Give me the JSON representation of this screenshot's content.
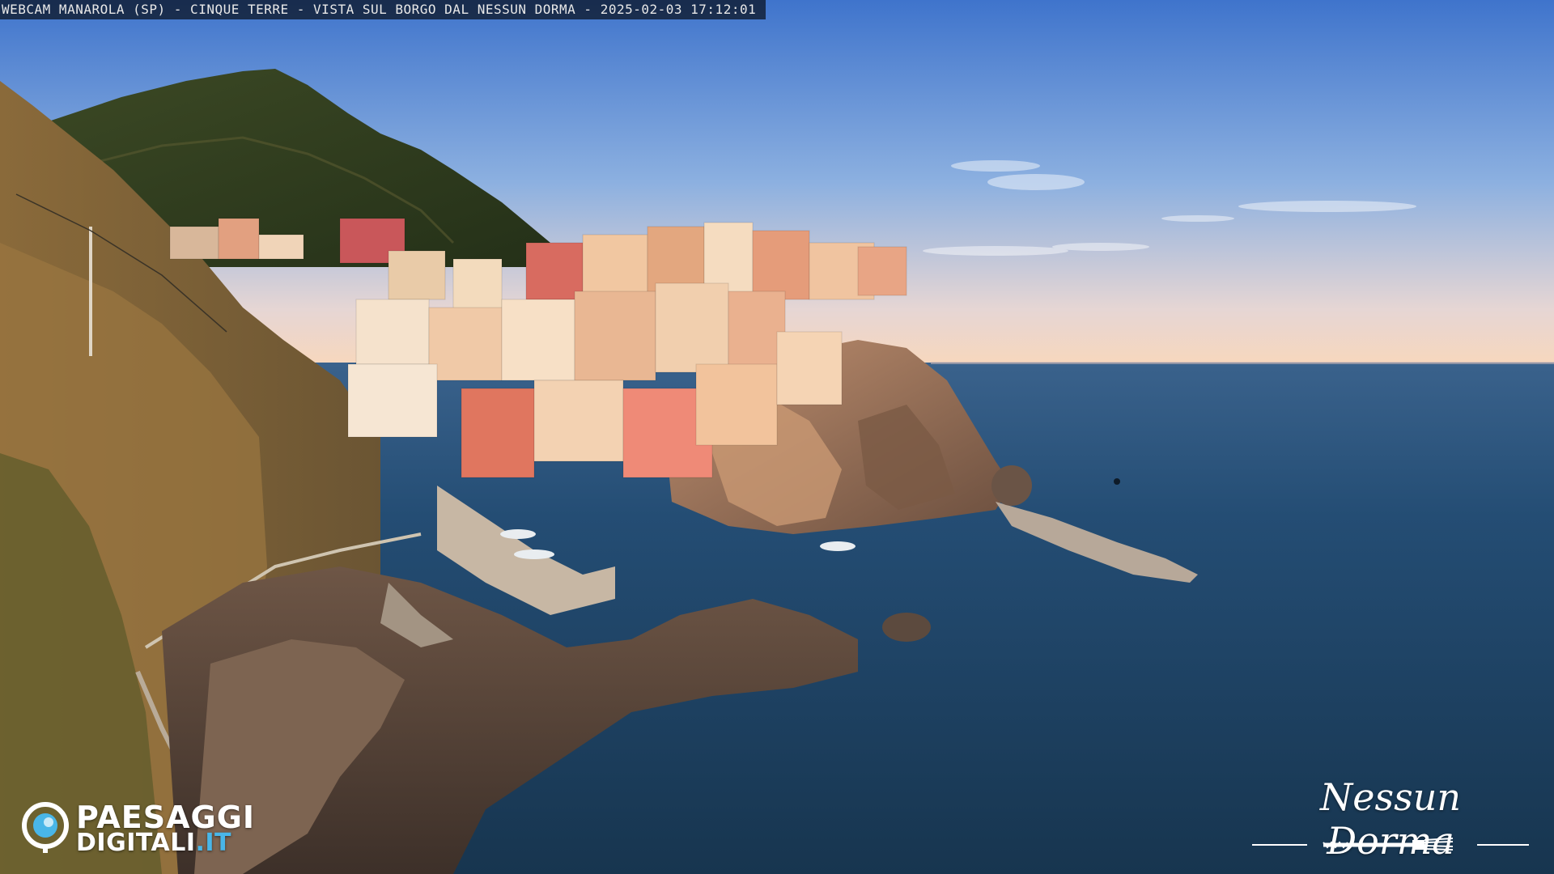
{
  "overlay": {
    "caption": "WEBCAM MANAROLA (SP) - CINQUE TERRE - VISTA SUL BORGO DAL NESSUN DORMA - 2025-02-03 17:12:01"
  },
  "logos": {
    "left_line1": "PAESAGGI",
    "left_line2_main": "DIGITALI",
    "left_line2_suffix": ".IT",
    "right_signature": "Nessun Dorma",
    "right_fork_icon": "fork-icon"
  },
  "colors": {
    "sky_top": "#4f86d6",
    "sky_horizon": "#f3d7c3",
    "sea": "#1d4467",
    "cliff": "#8c6a50",
    "logo_accent": "#49b6e8"
  }
}
